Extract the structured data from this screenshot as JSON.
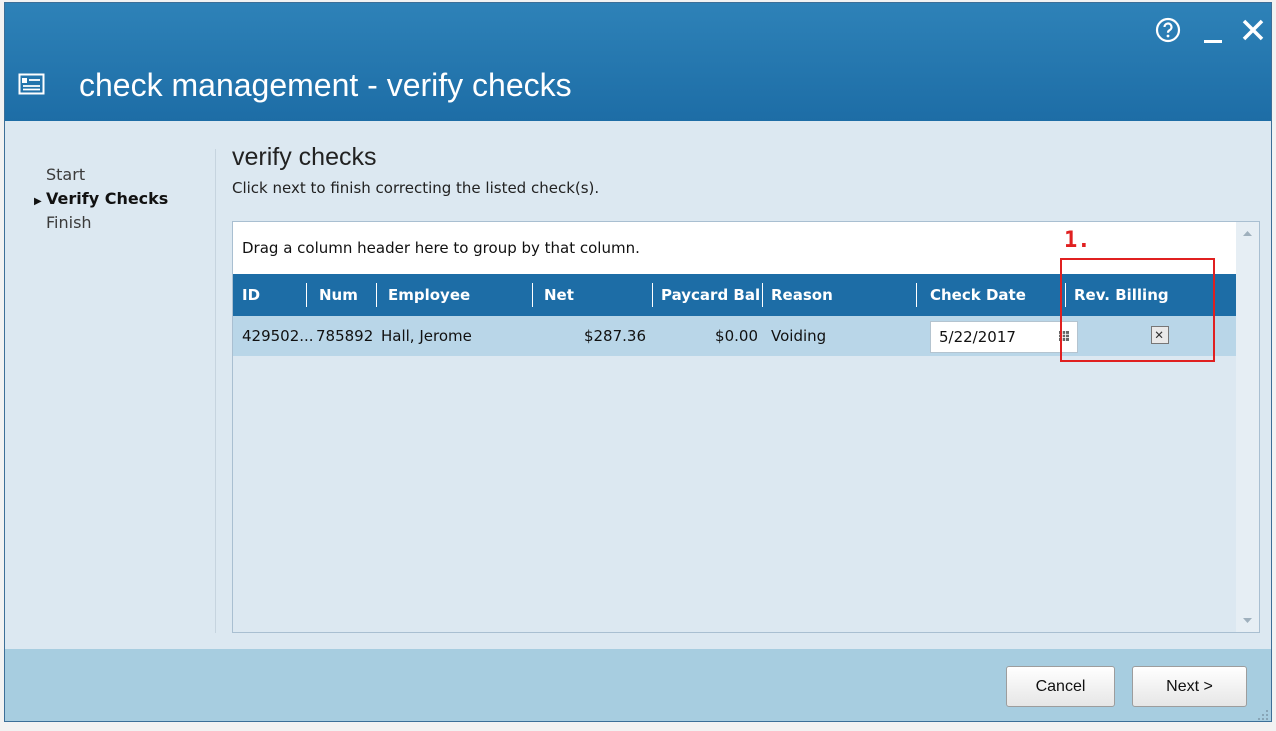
{
  "window": {
    "title": "check management - verify checks",
    "title_icon": "check-card-icon",
    "controls": {
      "help_icon": "help-circle-icon",
      "minimize_icon": "minimize-icon",
      "close_icon": "close-icon"
    }
  },
  "wizard": {
    "steps": [
      {
        "label": "Start",
        "active": false
      },
      {
        "label": "Verify Checks",
        "active": true
      },
      {
        "label": "Finish",
        "active": false
      }
    ]
  },
  "page": {
    "title": "verify checks",
    "subtitle": "Click next to finish correcting the listed check(s)."
  },
  "grid": {
    "group_hint": "Drag a column header here to group by that column.",
    "columns": [
      "ID",
      "Num",
      "Employee",
      "Net",
      "Paycard Bal",
      "Reason",
      "Check Date",
      "Rev. Billing"
    ],
    "rows": [
      {
        "id": "429502...",
        "num": "785892",
        "employee": "Hall, Jerome",
        "net": "$287.36",
        "paycard_bal": "$0.00",
        "reason": "Voiding",
        "check_date": "5/22/2017",
        "rev_billing": "✕"
      }
    ]
  },
  "annotation": {
    "label": "1.",
    "color": "#e02020"
  },
  "footer": {
    "cancel_label": "Cancel",
    "next_label": "Next >"
  },
  "colors": {
    "accent": "#1d6da6",
    "row_selected": "#b9d6e8",
    "footer": "#a7cde0",
    "body": "#dce8f1"
  }
}
